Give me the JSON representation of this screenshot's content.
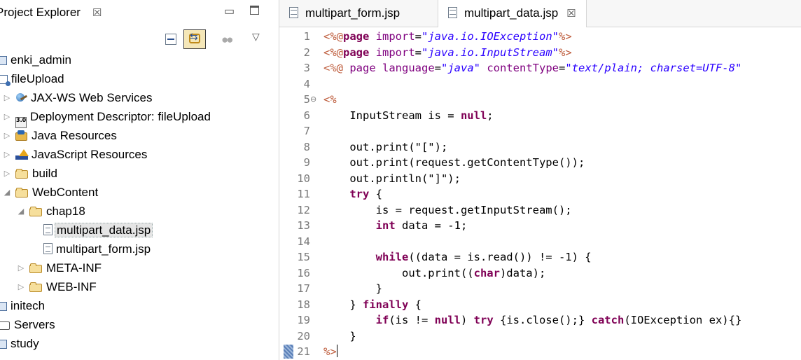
{
  "explorer": {
    "title": "Project Explorer",
    "close_glyph": "☒",
    "tree": [
      {
        "label": "enki_admin",
        "icon": "project-icon",
        "indent": 0,
        "twisty": ""
      },
      {
        "label": "fileUpload",
        "icon": "web-project-icon",
        "indent": 0,
        "twisty": ""
      },
      {
        "label": "JAX-WS Web Services",
        "icon": "jaxws-icon",
        "indent": 1,
        "twisty": "▷"
      },
      {
        "label": "Deployment Descriptor: fileUpload",
        "icon": "deployment-descriptor-icon",
        "indent": 1,
        "twisty": "▷"
      },
      {
        "label": "Java Resources",
        "icon": "java-resources-icon",
        "indent": 1,
        "twisty": "▷"
      },
      {
        "label": "JavaScript Resources",
        "icon": "javascript-resources-icon",
        "indent": 1,
        "twisty": "▷"
      },
      {
        "label": "build",
        "icon": "folder-icon",
        "indent": 1,
        "twisty": "▷"
      },
      {
        "label": "WebContent",
        "icon": "folder-icon",
        "indent": 1,
        "twisty": "◢"
      },
      {
        "label": "chap18",
        "icon": "folder-icon",
        "indent": 2,
        "twisty": "◢"
      },
      {
        "label": "multipart_data.jsp",
        "icon": "jsp-file-icon",
        "indent": 3,
        "twisty": "",
        "selected": true
      },
      {
        "label": "multipart_form.jsp",
        "icon": "jsp-file-icon",
        "indent": 3,
        "twisty": ""
      },
      {
        "label": "META-INF",
        "icon": "folder-icon",
        "indent": 2,
        "twisty": "▷"
      },
      {
        "label": "WEB-INF",
        "icon": "folder-icon",
        "indent": 2,
        "twisty": "▷"
      },
      {
        "label": "initech",
        "icon": "project-icon",
        "indent": 0,
        "twisty": ""
      },
      {
        "label": "Servers",
        "icon": "servers-folder-icon",
        "indent": 0,
        "twisty": ""
      },
      {
        "label": "study",
        "icon": "project-icon",
        "indent": 0,
        "twisty": ""
      }
    ]
  },
  "editor": {
    "tabs": [
      {
        "label": "multipart_form.jsp",
        "active": false
      },
      {
        "label": "multipart_data.jsp",
        "active": true,
        "close_glyph": "☒"
      }
    ],
    "lines": [
      {
        "n": "1",
        "tokens": [
          [
            "tagc",
            "<%@"
          ],
          [
            "k",
            "page"
          ],
          [
            "plain",
            " "
          ],
          [
            "attr",
            "import"
          ],
          [
            "plain",
            "="
          ],
          [
            "str",
            "\"java.io.IOException\""
          ],
          [
            "tagc",
            "%>"
          ]
        ]
      },
      {
        "n": "2",
        "tokens": [
          [
            "tagc",
            "<%@"
          ],
          [
            "k",
            "page"
          ],
          [
            "plain",
            " "
          ],
          [
            "attr",
            "import"
          ],
          [
            "plain",
            "="
          ],
          [
            "str",
            "\"java.io.InputStream\""
          ],
          [
            "tagc",
            "%>"
          ]
        ]
      },
      {
        "n": "3",
        "tokens": [
          [
            "tagc",
            "<%@ "
          ],
          [
            "attr",
            "page"
          ],
          [
            "plain",
            " "
          ],
          [
            "attr",
            "language"
          ],
          [
            "plain",
            "="
          ],
          [
            "str",
            "\"java\""
          ],
          [
            "plain",
            " "
          ],
          [
            "attr",
            "contentType"
          ],
          [
            "plain",
            "="
          ],
          [
            "str",
            "\"text/plain; charset=UTF-8\""
          ]
        ]
      },
      {
        "n": "4",
        "tokens": []
      },
      {
        "n": "5",
        "fold": "⊖",
        "tokens": [
          [
            "tagc",
            "<%"
          ]
        ]
      },
      {
        "n": "6",
        "tokens": [
          [
            "plain",
            "    InputStream is = "
          ],
          [
            "k",
            "null"
          ],
          [
            "plain",
            ";"
          ]
        ]
      },
      {
        "n": "7",
        "tokens": []
      },
      {
        "n": "8",
        "tokens": [
          [
            "plain",
            "    out.print(\"[\");"
          ]
        ]
      },
      {
        "n": "9",
        "tokens": [
          [
            "plain",
            "    out.print(request.getContentType());"
          ]
        ]
      },
      {
        "n": "10",
        "tokens": [
          [
            "plain",
            "    out.println(\"]\");"
          ]
        ]
      },
      {
        "n": "11",
        "tokens": [
          [
            "plain",
            "    "
          ],
          [
            "k",
            "try"
          ],
          [
            "plain",
            " {"
          ]
        ]
      },
      {
        "n": "12",
        "tokens": [
          [
            "plain",
            "        is = request.getInputStream();"
          ]
        ]
      },
      {
        "n": "13",
        "tokens": [
          [
            "plain",
            "        "
          ],
          [
            "k",
            "int"
          ],
          [
            "plain",
            " data = -1;"
          ]
        ]
      },
      {
        "n": "14",
        "tokens": []
      },
      {
        "n": "15",
        "tokens": [
          [
            "plain",
            "        "
          ],
          [
            "k",
            "while"
          ],
          [
            "plain",
            "((data = is.read()) != -1) {"
          ]
        ]
      },
      {
        "n": "16",
        "tokens": [
          [
            "plain",
            "            out.print(("
          ],
          [
            "k",
            "char"
          ],
          [
            "plain",
            ")data);"
          ]
        ]
      },
      {
        "n": "17",
        "tokens": [
          [
            "plain",
            "        }"
          ]
        ]
      },
      {
        "n": "18",
        "tokens": [
          [
            "plain",
            "    } "
          ],
          [
            "k",
            "finally"
          ],
          [
            "plain",
            " {"
          ]
        ]
      },
      {
        "n": "19",
        "tokens": [
          [
            "plain",
            "        "
          ],
          [
            "k",
            "if"
          ],
          [
            "plain",
            "(is != "
          ],
          [
            "k",
            "null"
          ],
          [
            "plain",
            ") "
          ],
          [
            "k",
            "try"
          ],
          [
            "plain",
            " {is.close();} "
          ],
          [
            "k",
            "catch"
          ],
          [
            "plain",
            "(IOException ex){}"
          ]
        ]
      },
      {
        "n": "20",
        "tokens": [
          [
            "plain",
            "    }"
          ]
        ]
      },
      {
        "n": "21",
        "marker": true,
        "caret": true,
        "tokens": [
          [
            "tagc",
            "%>"
          ]
        ]
      }
    ]
  }
}
